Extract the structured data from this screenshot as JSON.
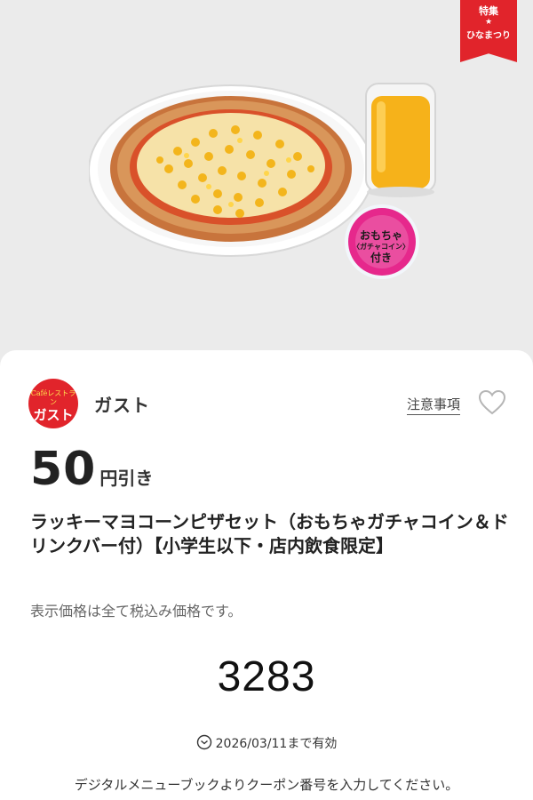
{
  "hero": {
    "ribbon": {
      "line1": "特集",
      "star": "★",
      "line2": "ひなまつり"
    },
    "badge": {
      "line1": "おもちゃ",
      "line2": "〈ガチャコイン〉",
      "line3": "付き"
    }
  },
  "coupon": {
    "logo": {
      "line1": "Caféレストラン",
      "line2": "ガスト"
    },
    "brand": "ガスト",
    "notice_link": "注意事項",
    "discount": {
      "amount": "50",
      "unit": "円引き"
    },
    "title": "ラッキーマヨコーンピザセット（おもちゃガチャコイン＆ドリンクバー付）【小学生以下・店内飲食限定】",
    "tax_note": "表示価格は全て税込み価格です。",
    "code": "3283",
    "expiry": "2026/03/11まで有効",
    "instruction": "デジタルメニューブックよりクーポン番号を入力してください。"
  },
  "colors": {
    "accent": "#e1242b",
    "badge_pink": "#e6288c",
    "corn": "#f3b51c"
  },
  "icons": [
    "heart-icon",
    "clock-icon"
  ]
}
